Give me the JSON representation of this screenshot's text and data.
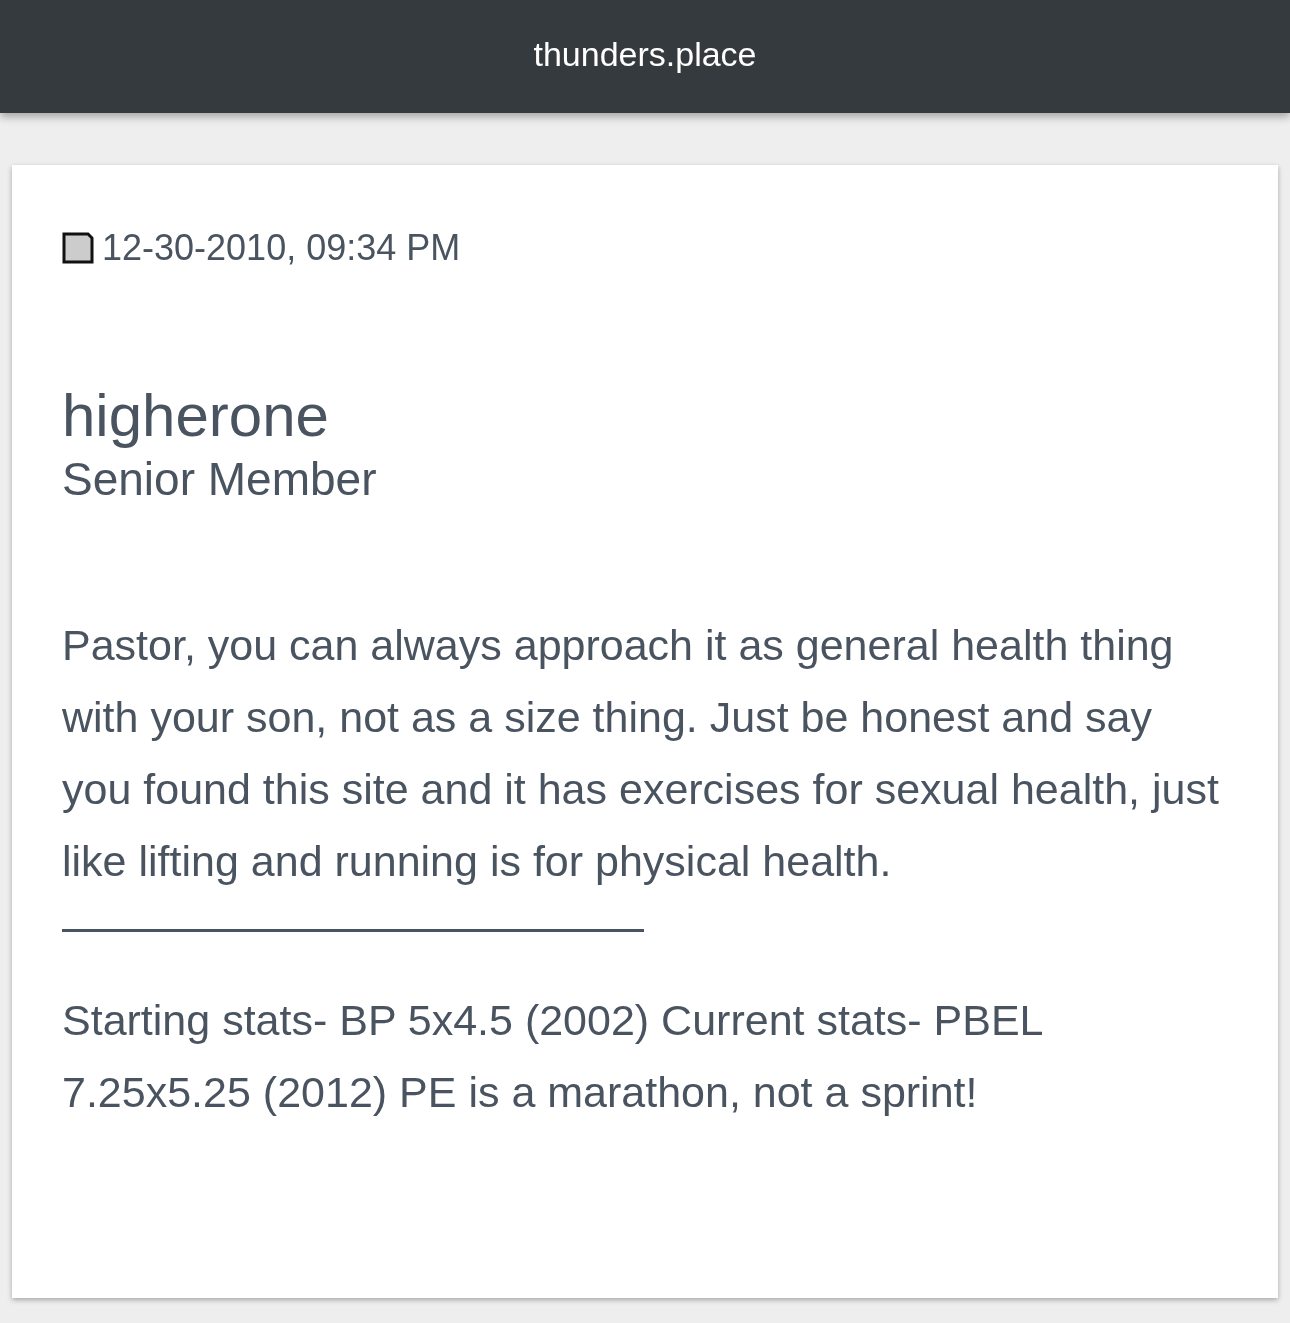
{
  "header": {
    "title": "thunders.place"
  },
  "post": {
    "date": "12-30-2010, 09:34 PM",
    "author": "higherone",
    "rank": "Senior Member",
    "body": "Pastor, you can always approach it as general health thing with your son, not as a size thing. Just be honest and say you found this site and it has exercises for sexual health, just like lifting and running is for physical health.",
    "signature": "Starting stats- BP 5x4.5 (2002) Current stats- PBEL 7.25x5.25 (2012) PE is a marathon, not a sprint!"
  }
}
